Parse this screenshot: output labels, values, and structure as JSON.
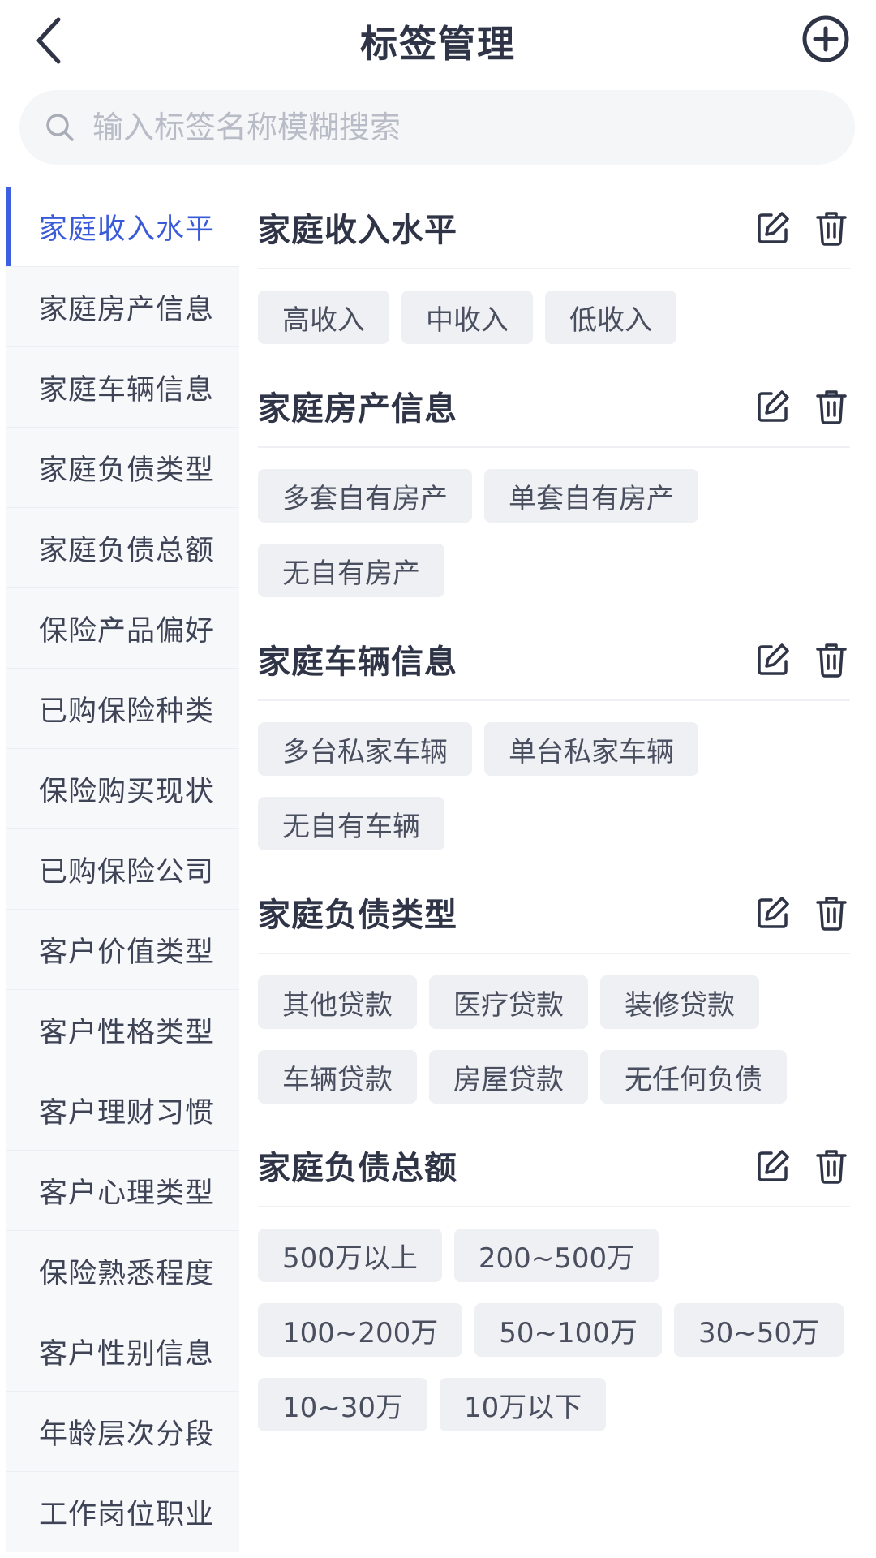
{
  "header": {
    "title": "标签管理"
  },
  "search": {
    "placeholder": "输入标签名称模糊搜索"
  },
  "sidebar": {
    "items": [
      {
        "label": "家庭收入水平",
        "active": true
      },
      {
        "label": "家庭房产信息"
      },
      {
        "label": "家庭车辆信息"
      },
      {
        "label": "家庭负债类型"
      },
      {
        "label": "家庭负债总额"
      },
      {
        "label": "保险产品偏好"
      },
      {
        "label": "已购保险种类"
      },
      {
        "label": "保险购买现状"
      },
      {
        "label": "已购保险公司"
      },
      {
        "label": "客户价值类型"
      },
      {
        "label": "客户性格类型"
      },
      {
        "label": "客户理财习惯"
      },
      {
        "label": "客户心理类型"
      },
      {
        "label": "保险熟悉程度"
      },
      {
        "label": "客户性别信息"
      },
      {
        "label": "年龄层次分段"
      },
      {
        "label": "工作岗位职业"
      }
    ]
  },
  "groups": [
    {
      "title": "家庭收入水平",
      "tags": [
        "高收入",
        "中收入",
        "低收入"
      ]
    },
    {
      "title": "家庭房产信息",
      "tags": [
        "多套自有房产",
        "单套自有房产",
        "无自有房产"
      ]
    },
    {
      "title": "家庭车辆信息",
      "tags": [
        "多台私家车辆",
        "单台私家车辆",
        "无自有车辆"
      ]
    },
    {
      "title": "家庭负债类型",
      "tags": [
        "其他贷款",
        "医疗贷款",
        "装修贷款",
        "车辆贷款",
        "房屋贷款",
        "无任何负债"
      ]
    },
    {
      "title": "家庭负债总额",
      "tags": [
        "500万以上",
        "200~500万",
        "100~200万",
        "50~100万",
        "30~50万",
        "10~30万",
        "10万以下"
      ]
    }
  ],
  "colors": {
    "accent": "#3e5fe0",
    "text": "#2f3446",
    "tag_bg": "#eef0f3",
    "sidebar_bg": "#f7f8fa"
  },
  "icons": {
    "back": "chevron-left-icon",
    "add": "plus-circle-icon",
    "search": "search-icon",
    "edit": "edit-icon",
    "delete": "trash-icon"
  }
}
